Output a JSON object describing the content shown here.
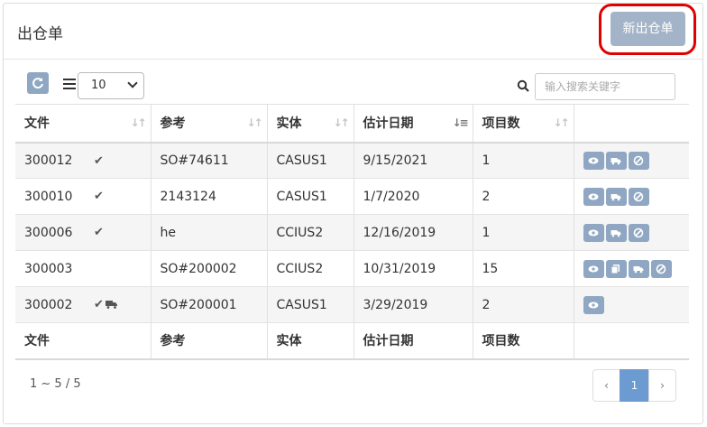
{
  "header": {
    "title": "出仓单",
    "new_button": "新出仓单"
  },
  "toolbar": {
    "page_size": "10",
    "search_placeholder": "输入搜索关键字"
  },
  "table": {
    "columns": [
      "文件",
      "参考",
      "实体",
      "估计日期",
      "项目数"
    ],
    "rows": [
      {
        "doc": "300012",
        "ref": "SO#74611",
        "entity": "CASUS1",
        "date": "9/15/2021",
        "count": "1",
        "checked": true,
        "truck_flag": false,
        "actions": [
          "view",
          "truck",
          "cancel"
        ]
      },
      {
        "doc": "300010",
        "ref": "2143124",
        "entity": "CASUS1",
        "date": "1/7/2020",
        "count": "2",
        "checked": true,
        "truck_flag": false,
        "actions": [
          "view",
          "truck",
          "cancel"
        ]
      },
      {
        "doc": "300006",
        "ref": "he",
        "entity": "CCIUS2",
        "date": "12/16/2019",
        "count": "1",
        "checked": true,
        "truck_flag": false,
        "actions": [
          "view",
          "truck",
          "cancel"
        ]
      },
      {
        "doc": "300003",
        "ref": "SO#200002",
        "entity": "CCIUS2",
        "date": "10/31/2019",
        "count": "15",
        "checked": false,
        "truck_flag": false,
        "actions": [
          "view",
          "copy",
          "truck",
          "cancel"
        ]
      },
      {
        "doc": "300002",
        "ref": "SO#200001",
        "entity": "CASUS1",
        "date": "3/29/2019",
        "count": "2",
        "checked": true,
        "truck_flag": true,
        "actions": [
          "view"
        ]
      }
    ]
  },
  "pagination": {
    "info": "1 ~ 5 / 5",
    "prev": "‹",
    "current": "1",
    "next": "›"
  },
  "colors": {
    "action_button": "#8fa7c2",
    "highlight_ring": "#e00000",
    "page_active": "#6b9bd1"
  }
}
